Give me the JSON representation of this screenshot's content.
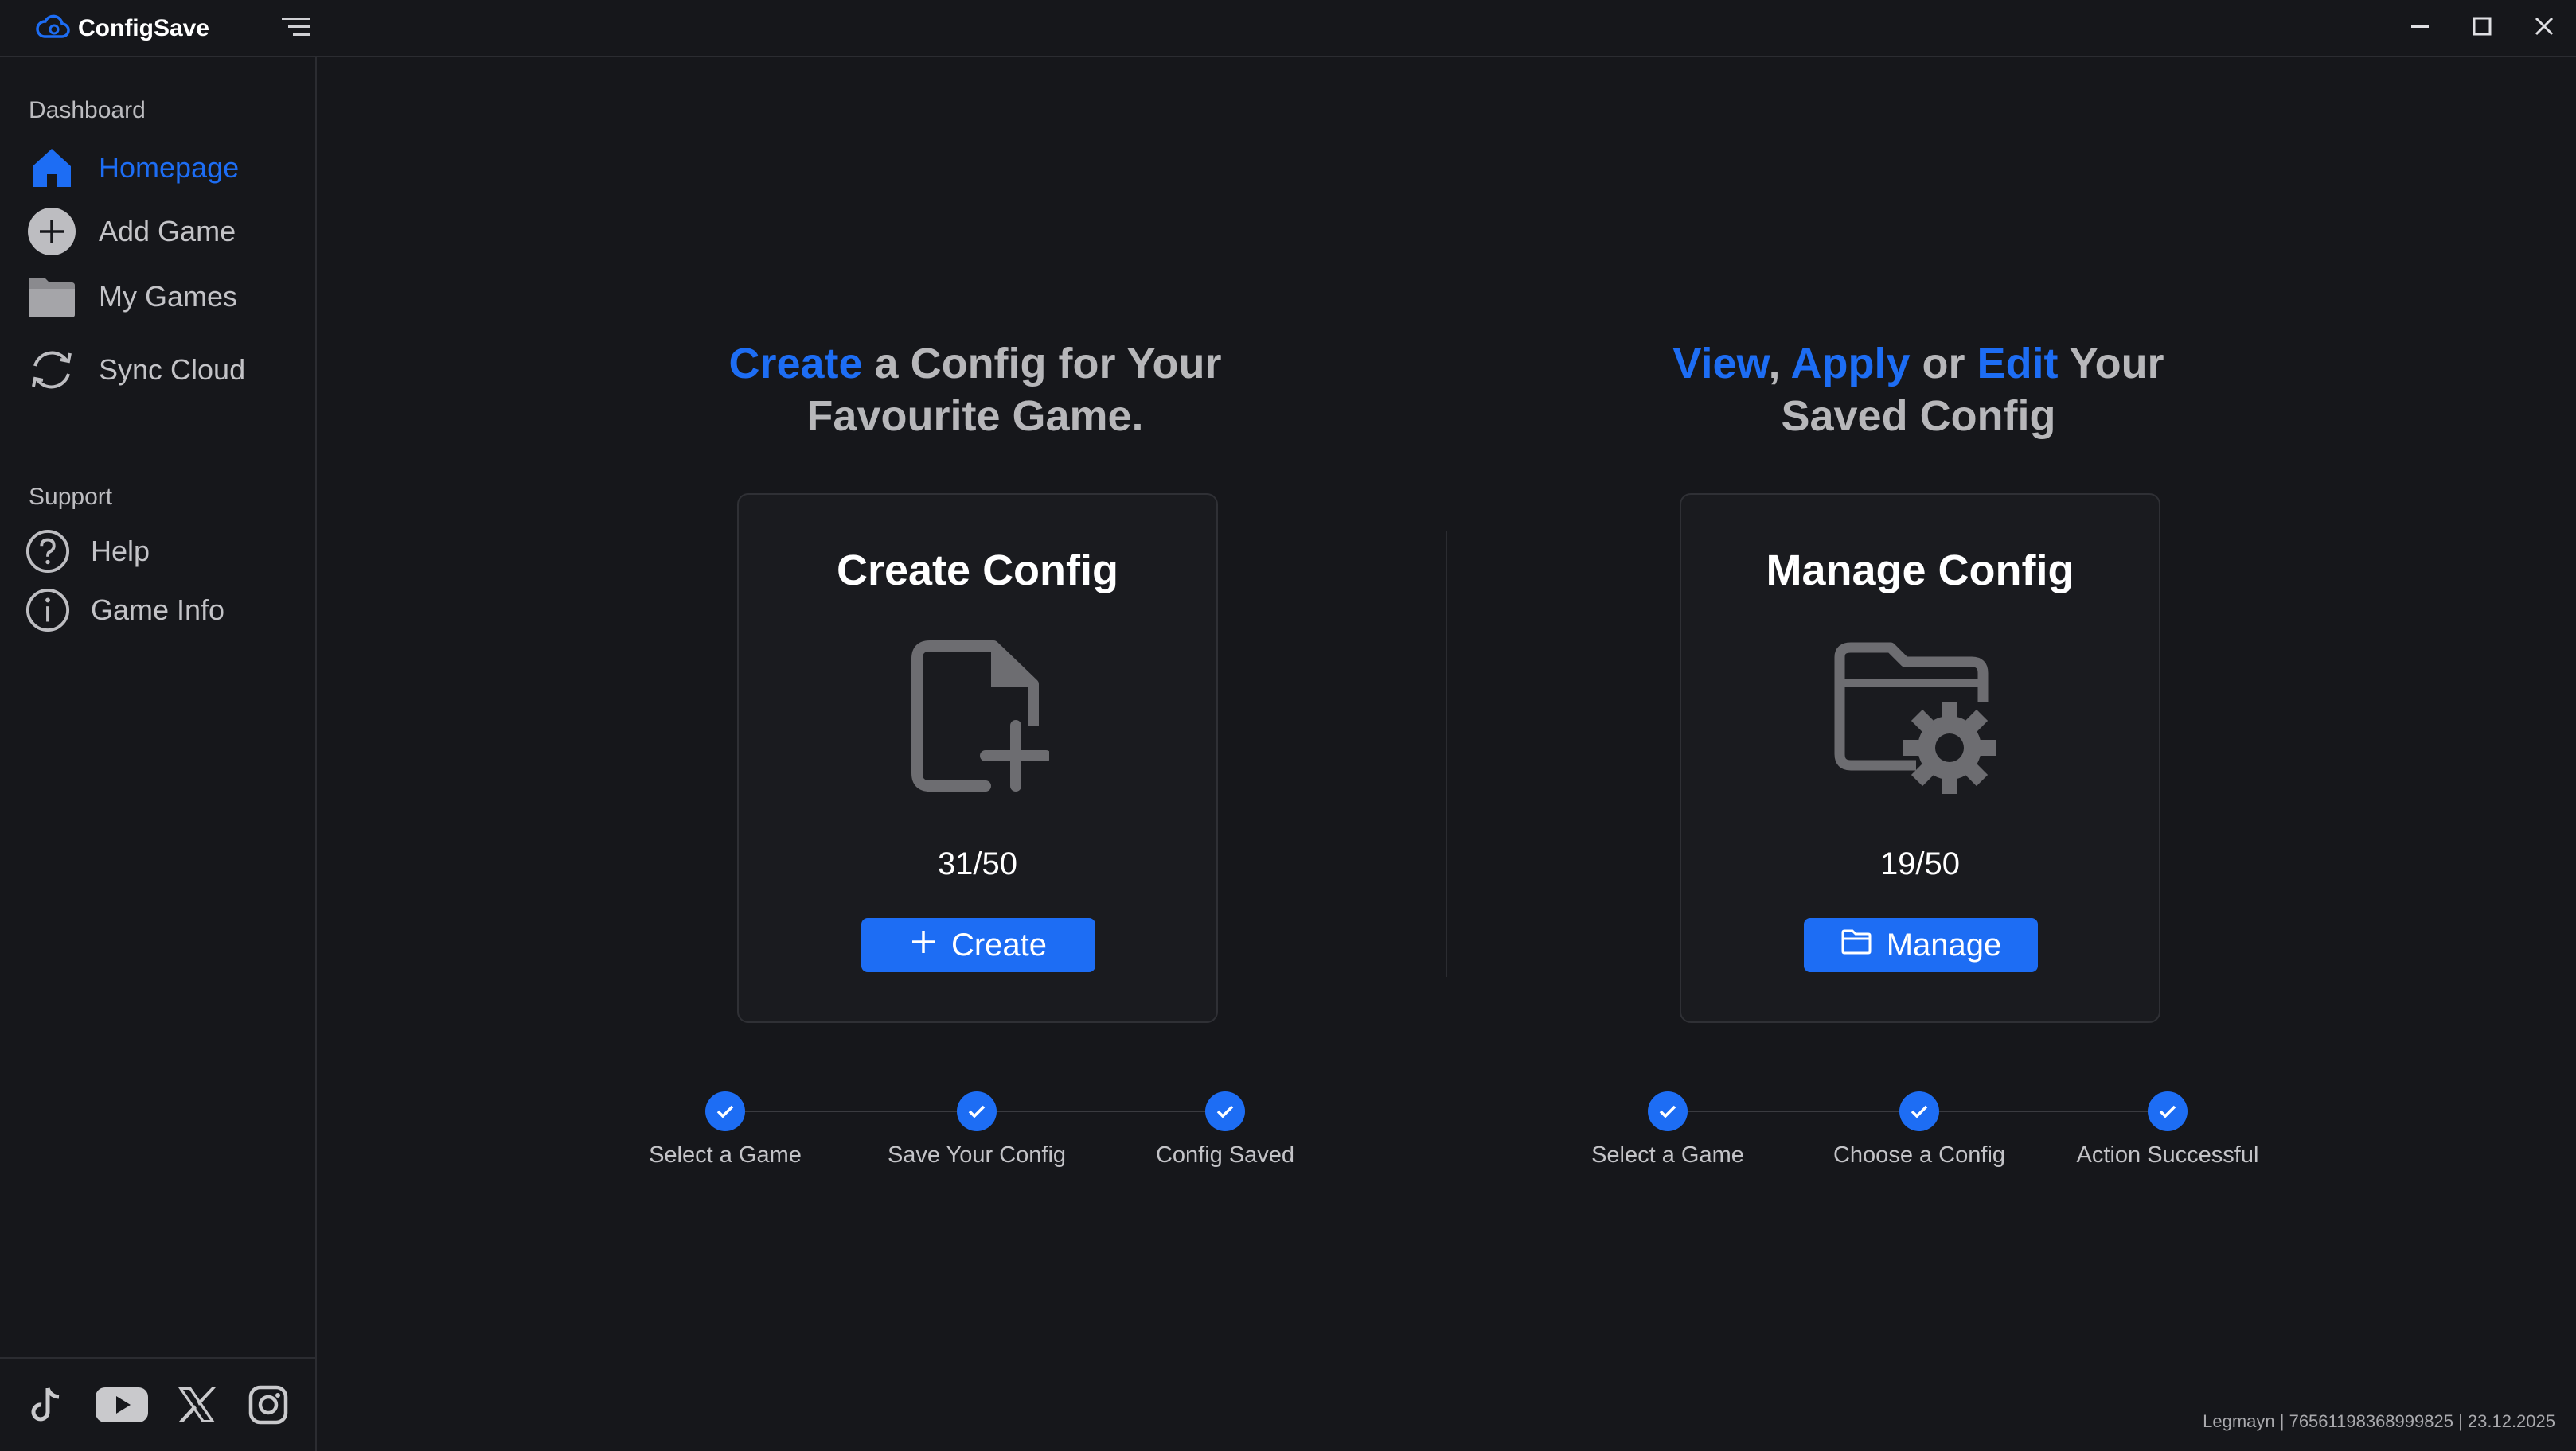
{
  "app": {
    "title": "ConfigSave",
    "accent_color": "#1d6df4"
  },
  "window_controls": [
    "minimize-icon",
    "maximize-icon",
    "close-icon"
  ],
  "sidebar": {
    "dashboard_label": "Dashboard",
    "items": [
      {
        "label": "Homepage",
        "icon": "home-icon",
        "active": true
      },
      {
        "label": "Add Game",
        "icon": "plus-circle-icon",
        "active": false
      },
      {
        "label": "My Games",
        "icon": "folder-icon",
        "active": false
      },
      {
        "label": "Sync Cloud",
        "icon": "sync-icon",
        "active": false
      }
    ],
    "support_label": "Support",
    "support_items": [
      {
        "label": "Help",
        "icon": "help-icon"
      },
      {
        "label": "Game Info",
        "icon": "info-icon"
      }
    ],
    "socials": [
      "tiktok-icon",
      "youtube-icon",
      "x-icon",
      "instagram-icon"
    ]
  },
  "create_section": {
    "heading_hl": "Create",
    "heading_rest1": " a Config for Your",
    "heading_line2": "Favourite Game.",
    "card_title": "Create Config",
    "count": "31/50",
    "button_label": "Create",
    "steps": [
      "Select a Game",
      "Save Your Config",
      "Config Saved"
    ]
  },
  "manage_section": {
    "heading_hl1": "View",
    "heading_sep1": ", ",
    "heading_hl2": "Apply",
    "heading_sep2": " or ",
    "heading_hl3": "Edit",
    "heading_rest": " Your",
    "heading_line2": "Saved Config",
    "card_title": "Manage Config",
    "count": "19/50",
    "button_label": "Manage",
    "steps": [
      "Select a Game",
      "Choose a Config",
      "Action Successful"
    ]
  },
  "footer_info": "Legmayn | 76561198368999825 | 23.12.2025"
}
